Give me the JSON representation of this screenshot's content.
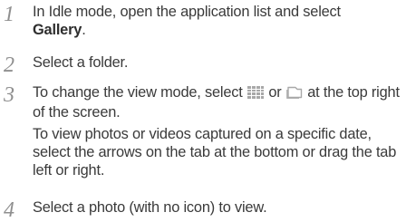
{
  "steps": [
    {
      "number": "1",
      "text_before": "In Idle mode, open the application list and select ",
      "bold": "Gallery",
      "text_after": "."
    },
    {
      "number": "2",
      "text": "Select a folder."
    },
    {
      "number": "3",
      "text_part1": "To change the view mode, select ",
      "icon_grid": "grid-view-icon",
      "text_part2": " or ",
      "icon_tab": "tab-view-icon",
      "text_part3": " at the top right of the screen.",
      "note": "To view photos or videos captured on a specific date, select the arrows on the tab at the bottom or drag the tab left or right."
    },
    {
      "number": "4",
      "text": "Select a photo (with no icon) to view."
    }
  ],
  "colors": {
    "text": "#3a3a3a",
    "step_number": "#8f8f8f",
    "icon": "#a8a8a8"
  }
}
